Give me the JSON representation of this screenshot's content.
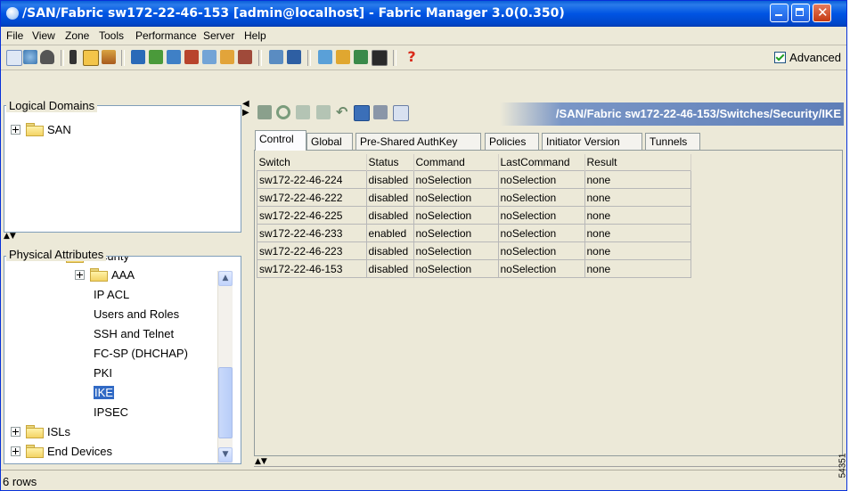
{
  "window": {
    "title": "/SAN/Fabric sw172-22-46-153 [admin@localhost] - Fabric Manager 3.0(0.350)",
    "colors": {
      "titlebar": "#0054e3",
      "selection": "#316ac5",
      "panel_border": "#7f9db9"
    }
  },
  "menu": [
    "File",
    "View",
    "Zone",
    "Tools",
    "Performance",
    "Server",
    "Help"
  ],
  "toolbar": {
    "advanced_label": "Advanced",
    "advanced_checked": true
  },
  "logical_domains": {
    "title": "Logical Domains",
    "items": [
      {
        "label": "SAN",
        "icon": "folder-icon"
      }
    ]
  },
  "physical_attributes": {
    "title": "Physical Attributes",
    "items": [
      {
        "label": "Security",
        "icon": "folder-icon"
      },
      {
        "label": "AAA",
        "icon": "folder-icon"
      },
      {
        "label": "IP ACL"
      },
      {
        "label": "Users and Roles"
      },
      {
        "label": "SSH and Telnet"
      },
      {
        "label": "FC-SP (DHCHAP)"
      },
      {
        "label": "PKI"
      },
      {
        "label": "IKE",
        "selected": true
      },
      {
        "label": "IPSEC"
      },
      {
        "label": "ISLs",
        "icon": "folder-icon"
      },
      {
        "label": "End Devices",
        "icon": "folder-icon"
      }
    ]
  },
  "content": {
    "path": "/SAN/Fabric sw172-22-46-153/Switches/Security/IKE",
    "tabs": [
      "Control",
      "Global",
      "Pre-Shared AuthKey",
      "Policies",
      "Initiator Version",
      "Tunnels"
    ],
    "active_tab": "Control",
    "table": {
      "headers": [
        "Switch",
        "Status",
        "Command",
        "LastCommand",
        "Result"
      ],
      "rows": [
        [
          "sw172-22-46-224",
          "disabled",
          "noSelection",
          "noSelection",
          "none"
        ],
        [
          "sw172-22-46-222",
          "disabled",
          "noSelection",
          "noSelection",
          "none"
        ],
        [
          "sw172-22-46-225",
          "disabled",
          "noSelection",
          "noSelection",
          "none"
        ],
        [
          "sw172-22-46-233",
          "enabled",
          "noSelection",
          "noSelection",
          "none"
        ],
        [
          "sw172-22-46-223",
          "disabled",
          "noSelection",
          "noSelection",
          "none"
        ],
        [
          "sw172-22-46-153",
          "disabled",
          "noSelection",
          "noSelection",
          "none"
        ]
      ]
    }
  },
  "status": {
    "text": "6 rows"
  },
  "side_label": "54351"
}
